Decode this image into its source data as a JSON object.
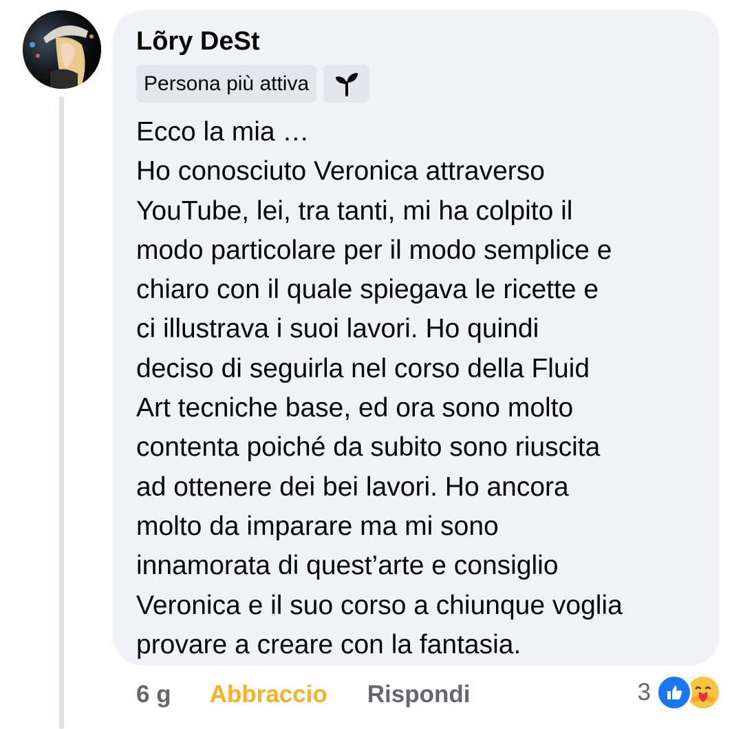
{
  "comment": {
    "author": "Lõry DeSt",
    "badge_label": "Persona più attiva",
    "badge_icon": "sprout-icon",
    "text": "Ecco la mia …\nHo conosciuto Veronica attraverso\nYouTube, lei, tra tanti, mi ha colpito il\nmodo particolare per il modo semplice e\nchiaro con il quale spiegava le ricette e\nci illustrava i suoi lavori. Ho quindi\ndeciso di seguirla nel corso della Fluid\nArt tecniche base, ed ora sono molto\ncontenta poiché da subito sono riuscita\nad ottenere dei bei lavori. Ho ancora\nmolto da imparare ma mi sono\ninnamorata di quest’arte e consiglio\nVeronica e il suo corso a chiunque voglia\nprovare a creare con la fantasia."
  },
  "actions": {
    "time": "6 g",
    "reaction_label": "Abbraccio",
    "reply_label": "Rispondi"
  },
  "reactions": {
    "count": "3",
    "icons": [
      "like-icon",
      "care-icon"
    ]
  },
  "colors": {
    "bubble": "#f0f2f5",
    "reaction_active": "#f7b125",
    "secondary_text": "#65676b",
    "like_blue": "#1877f2"
  }
}
